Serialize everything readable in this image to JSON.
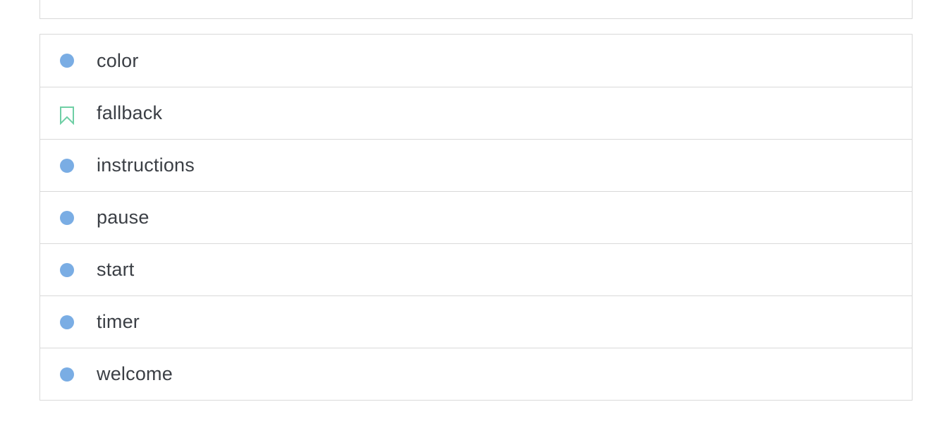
{
  "colors": {
    "dot": "#7aade4",
    "bookmark": "#6fcfa5",
    "border": "#d9d9d9",
    "text": "#3b3f45"
  },
  "items": [
    {
      "label": "color",
      "icon": "dot-icon"
    },
    {
      "label": "fallback",
      "icon": "bookmark-icon"
    },
    {
      "label": "instructions",
      "icon": "dot-icon"
    },
    {
      "label": "pause",
      "icon": "dot-icon"
    },
    {
      "label": "start",
      "icon": "dot-icon"
    },
    {
      "label": "timer",
      "icon": "dot-icon"
    },
    {
      "label": "welcome",
      "icon": "dot-icon"
    }
  ]
}
